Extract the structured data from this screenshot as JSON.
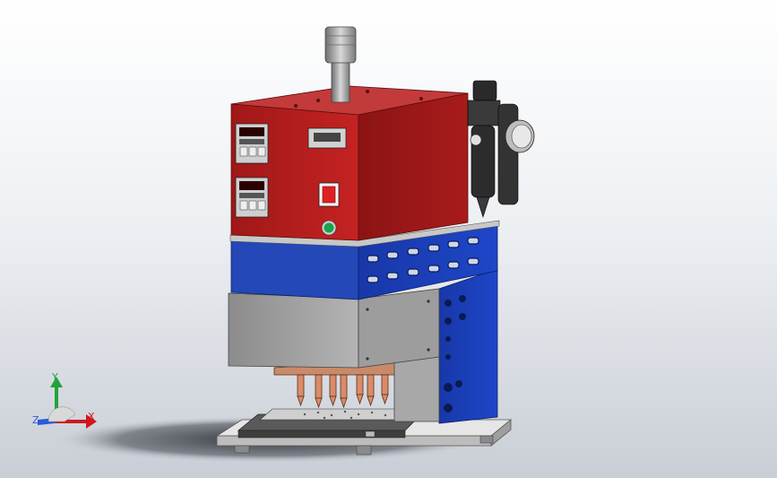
{
  "model_view": {
    "colors": {
      "housing_red": "#b71c1c",
      "housing_blue": "#1a3fb0",
      "guard_gray": "#9a9a9a",
      "base_plate": "#d9d9d9",
      "copper_tips": "#d98c6a",
      "power_switch": "#e02020",
      "indicator_lamp": "#1aa34a"
    },
    "triad": {
      "x_label": "X",
      "y_label": "Y",
      "z_label": "Z",
      "x_color": "#d0181c",
      "y_color": "#21a33a",
      "z_color": "#2b5bd7"
    },
    "icons": [
      "controller-display-icon",
      "pressure-gauge-icon",
      "power-switch-icon",
      "indicator-lamp-icon"
    ]
  }
}
